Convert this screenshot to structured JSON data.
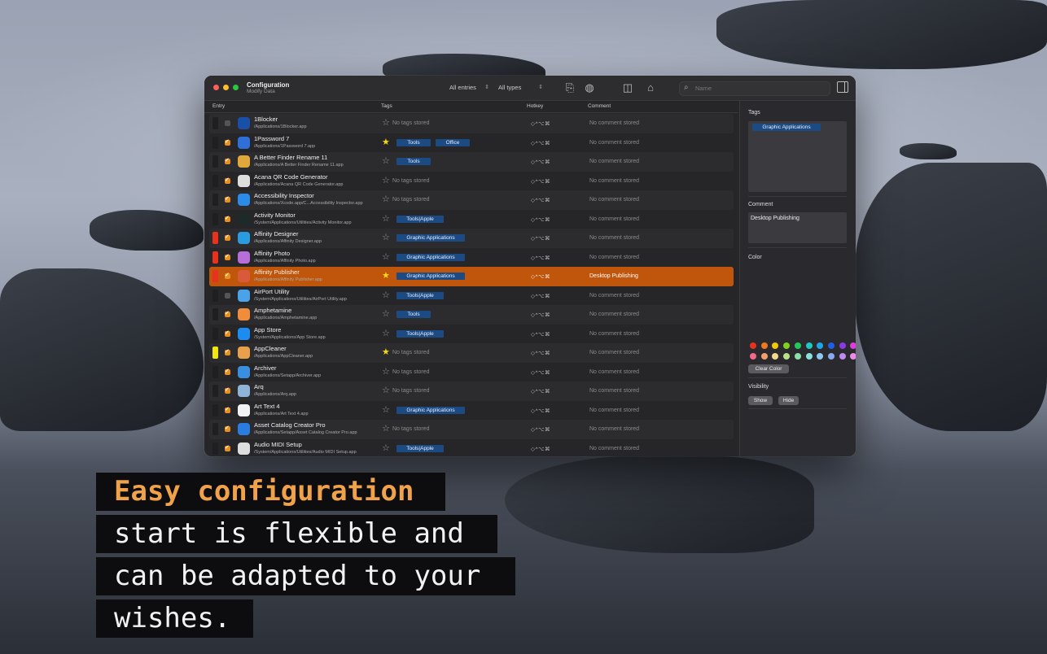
{
  "window": {
    "title": "Configuration",
    "subtitle": "Modify Data",
    "filter_entries": "All entries",
    "filter_types": "All types",
    "search_placeholder": "Name"
  },
  "columns": {
    "entry": "Entry",
    "tags": "Tags",
    "hotkey": "Hotkey",
    "comment": "Comment"
  },
  "rows": [
    {
      "name": "1Blocker",
      "path": "/Applications/1Blocker.app",
      "checked": false,
      "fav": false,
      "tags": [],
      "color": "",
      "hotkey": "◇^⌥⌘",
      "comment": "No comment stored",
      "icon": "#1a4fa8"
    },
    {
      "name": "1Password 7",
      "path": "/Applications/1Password 7.app",
      "checked": true,
      "fav": true,
      "tags": [
        "Tools",
        "Office"
      ],
      "color": "",
      "hotkey": "◇^⌥⌘",
      "comment": "No comment stored",
      "icon": "#2f6fd8"
    },
    {
      "name": "A Better Finder Rename 11",
      "path": "/Applications/A Better Finder Rename 11.app",
      "checked": true,
      "fav": false,
      "tags": [
        "Tools"
      ],
      "color": "",
      "hotkey": "◇^⌥⌘",
      "comment": "No comment stored",
      "icon": "#e0a83a"
    },
    {
      "name": "Acana QR Code Generator",
      "path": "/Applications/Acana QR Code Generator.app",
      "checked": true,
      "fav": false,
      "tags": [],
      "color": "",
      "hotkey": "◇^⌥⌘",
      "comment": "No comment stored",
      "icon": "#dddddd"
    },
    {
      "name": "Accessibility Inspector",
      "path": "/Applications/Xcode.app/C...Accessibility Inspector.app",
      "checked": true,
      "fav": false,
      "tags": [],
      "color": "",
      "hotkey": "◇^⌥⌘",
      "comment": "No comment stored",
      "icon": "#2a8ce8"
    },
    {
      "name": "Activity Monitor",
      "path": "/System/Applications/Utilities/Activity Monitor.app",
      "checked": true,
      "fav": false,
      "tags": [
        "Tools|Apple"
      ],
      "color": "",
      "hotkey": "◇^⌥⌘",
      "comment": "No comment stored",
      "icon": "#1e2a2a"
    },
    {
      "name": "Affinity Designer",
      "path": "/Applications/Affinity Designer.app",
      "checked": true,
      "fav": false,
      "tags": [
        "Graphic Applications"
      ],
      "color": "#e8311f",
      "hotkey": "◇^⌥⌘",
      "comment": "No comment stored",
      "icon": "#2b9be0"
    },
    {
      "name": "Affinity Photo",
      "path": "/Applications/Affinity Photo.app",
      "checked": true,
      "fav": false,
      "tags": [
        "Graphic Applications"
      ],
      "color": "#e8311f",
      "hotkey": "◇^⌥⌘",
      "comment": "No comment stored",
      "icon": "#b76ed8"
    },
    {
      "name": "Affinity Publisher",
      "path": "/Applications/Affinity Publisher.app",
      "checked": true,
      "fav": true,
      "tags": [
        "Graphic Applications"
      ],
      "color": "#e8311f",
      "hotkey": "◇^⌥⌘",
      "comment": "Desktop Publishing",
      "icon": "#d85a3a",
      "selected": true
    },
    {
      "name": "AirPort Utility",
      "path": "/System/Applications/Utilities/AirPort Utility.app",
      "checked": false,
      "fav": false,
      "tags": [
        "Tools|Apple"
      ],
      "color": "",
      "hotkey": "◇^⌥⌘",
      "comment": "No comment stored",
      "icon": "#4aa3e8"
    },
    {
      "name": "Amphetamine",
      "path": "/Applications/Amphetamine.app",
      "checked": true,
      "fav": false,
      "tags": [
        "Tools"
      ],
      "color": "",
      "hotkey": "◇^⌥⌘",
      "comment": "No comment stored",
      "icon": "#f08c3a"
    },
    {
      "name": "App Store",
      "path": "/System/Applications/App Store.app",
      "checked": true,
      "fav": false,
      "tags": [
        "Tools|Apple"
      ],
      "color": "",
      "hotkey": "◇^⌥⌘",
      "comment": "No comment stored",
      "icon": "#1d8cf0"
    },
    {
      "name": "AppCleaner",
      "path": "/Applications/AppCleaner.app",
      "checked": true,
      "fav": true,
      "tags": [],
      "color": "#f2e60f",
      "hotkey": "◇^⌥⌘",
      "comment": "No comment stored",
      "icon": "#e8a04a"
    },
    {
      "name": "Archiver",
      "path": "/Applications/Setapp/Archiver.app",
      "checked": true,
      "fav": false,
      "tags": [],
      "color": "",
      "hotkey": "◇^⌥⌘",
      "comment": "No comment stored",
      "icon": "#3a8ee0"
    },
    {
      "name": "Arq",
      "path": "/Applications/Arq.app",
      "checked": true,
      "fav": false,
      "tags": [],
      "color": "",
      "hotkey": "◇^⌥⌘",
      "comment": "No comment stored",
      "icon": "#8fb4d8"
    },
    {
      "name": "Art Text 4",
      "path": "/Applications/Art Text 4.app",
      "checked": true,
      "fav": false,
      "tags": [
        "Graphic Applications"
      ],
      "color": "",
      "hotkey": "◇^⌥⌘",
      "comment": "No comment stored",
      "icon": "#f2f2f2"
    },
    {
      "name": "Asset Catalog Creator Pro",
      "path": "/Applications/Setapp/Asset Catalog Creator Pro.app",
      "checked": true,
      "fav": false,
      "tags": [],
      "color": "",
      "hotkey": "◇^⌥⌘",
      "comment": "No comment stored",
      "icon": "#2a7de0"
    },
    {
      "name": "Audio MIDI Setup",
      "path": "/System/Applications/Utilities/Audio MIDI Setup.app",
      "checked": true,
      "fav": false,
      "tags": [
        "Tools|Apple"
      ],
      "color": "",
      "hotkey": "◇^⌥⌘",
      "comment": "No comment stored",
      "icon": "#dddddd"
    }
  ],
  "no_tags_text": "No tags stored",
  "panel": {
    "tags_label": "Tags",
    "selected_tag": "Graphic Applications",
    "comment_label": "Comment",
    "comment_value": "Desktop Publishing",
    "color_label": "Color",
    "colors": [
      "#e8311f",
      "#f0781e",
      "#f2c60f",
      "#7fd11e",
      "#22c95a",
      "#1fc7c0",
      "#1fa4e8",
      "#1f5fe8",
      "#8a3ae8",
      "#e03ae0",
      "#f06a8a",
      "#f4a06a",
      "#f4d88a",
      "#b8e08a",
      "#8ae0a8",
      "#8ae0dc",
      "#8acaf0",
      "#8aa8f0",
      "#c08af0",
      "#f08ae8"
    ],
    "clear_color": "Clear Color",
    "visibility_label": "Visibility",
    "show": "Show",
    "hide": "Hide"
  },
  "caption": {
    "line1": "Easy configuration",
    "line2": "start is flexible and",
    "line3": "can be adapted to your",
    "line4": "wishes."
  }
}
